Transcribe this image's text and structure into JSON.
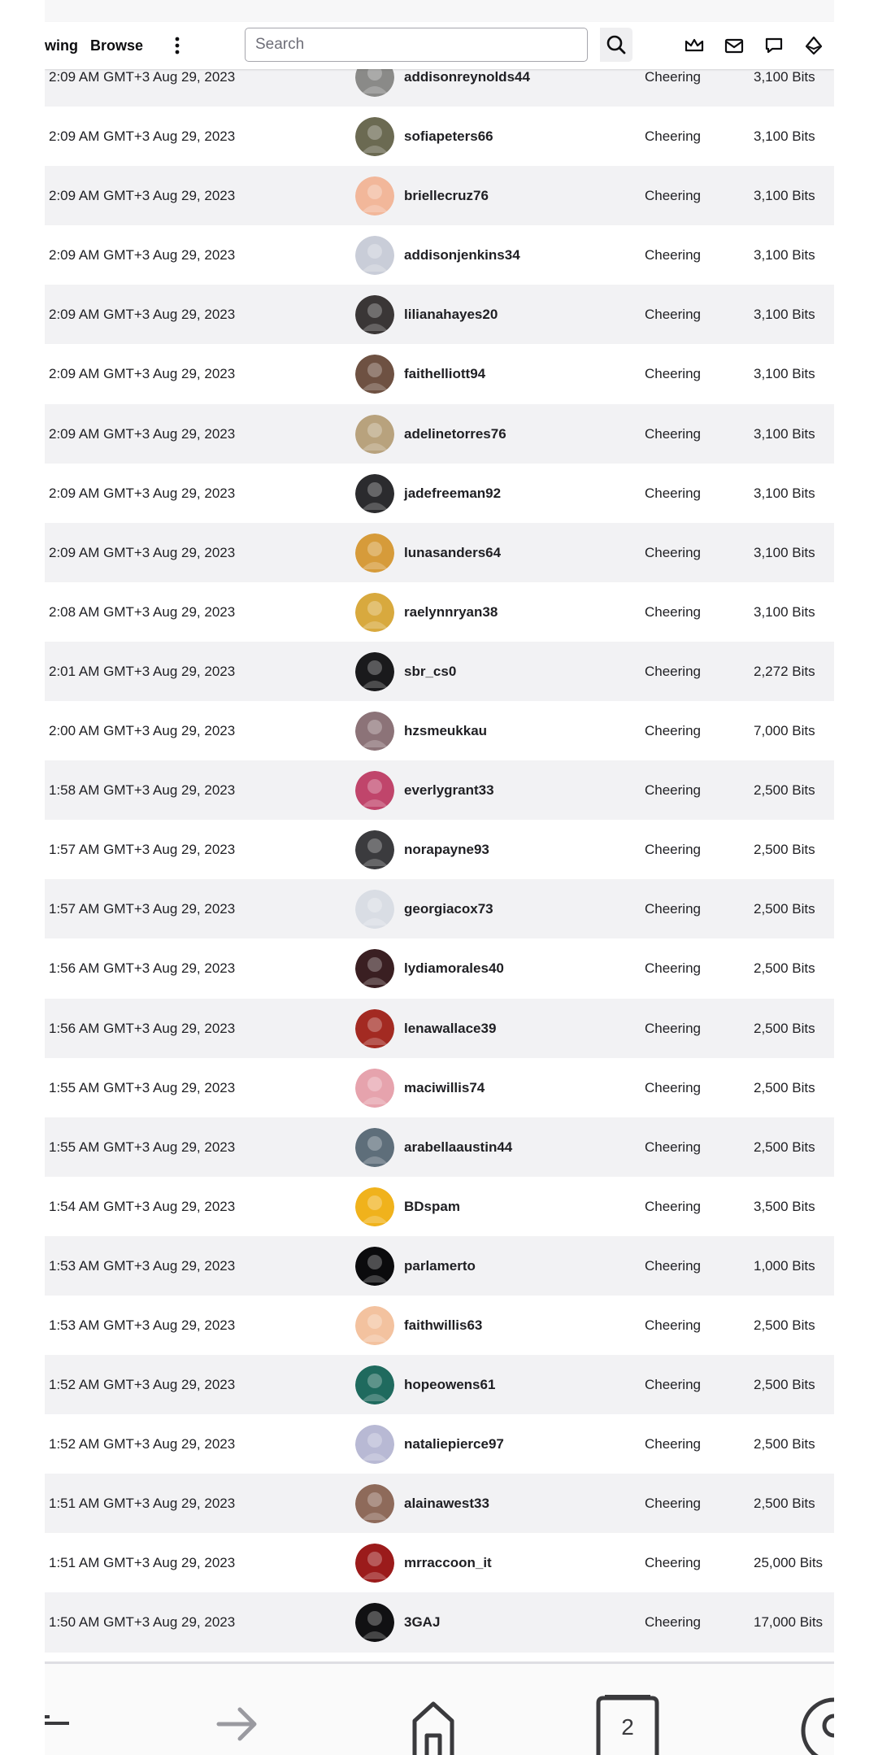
{
  "header": {
    "nav_following": "wing",
    "nav_browse": "Browse",
    "search_placeholder": "Search",
    "icons": [
      "more-vertical-icon",
      "search-icon",
      "crown-icon",
      "inbox-icon",
      "whispers-icon",
      "bits-icon"
    ]
  },
  "rows": [
    {
      "date": "2:09 AM GMT+3 Aug 29, 2023",
      "user": "addisonreynolds44",
      "type": "Cheering",
      "amount": "3,100 Bits",
      "avatar_color": "#8a8a88"
    },
    {
      "date": "2:09 AM GMT+3 Aug 29, 2023",
      "user": "sofiapeters66",
      "type": "Cheering",
      "amount": "3,100 Bits",
      "avatar_color": "#6b6a52"
    },
    {
      "date": "2:09 AM GMT+3 Aug 29, 2023",
      "user": "briellecruz76",
      "type": "Cheering",
      "amount": "3,100 Bits",
      "avatar_color": "#f2b79a"
    },
    {
      "date": "2:09 AM GMT+3 Aug 29, 2023",
      "user": "addisonjenkins34",
      "type": "Cheering",
      "amount": "3,100 Bits",
      "avatar_color": "#c9cdd8"
    },
    {
      "date": "2:09 AM GMT+3 Aug 29, 2023",
      "user": "lilianahayes20",
      "type": "Cheering",
      "amount": "3,100 Bits",
      "avatar_color": "#3a3636"
    },
    {
      "date": "2:09 AM GMT+3 Aug 29, 2023",
      "user": "faithelliott94",
      "type": "Cheering",
      "amount": "3,100 Bits",
      "avatar_color": "#6e5142"
    },
    {
      "date": "2:09 AM GMT+3 Aug 29, 2023",
      "user": "adelinetorres76",
      "type": "Cheering",
      "amount": "3,100 Bits",
      "avatar_color": "#b8a27d"
    },
    {
      "date": "2:09 AM GMT+3 Aug 29, 2023",
      "user": "jadefreeman92",
      "type": "Cheering",
      "amount": "3,100 Bits",
      "avatar_color": "#2b2b2e"
    },
    {
      "date": "2:09 AM GMT+3 Aug 29, 2023",
      "user": "lunasanders64",
      "type": "Cheering",
      "amount": "3,100 Bits",
      "avatar_color": "#d69b3a"
    },
    {
      "date": "2:08 AM GMT+3 Aug 29, 2023",
      "user": "raelynnryan38",
      "type": "Cheering",
      "amount": "3,100 Bits",
      "avatar_color": "#d8a93e"
    },
    {
      "date": "2:01 AM GMT+3 Aug 29, 2023",
      "user": "sbr_cs0",
      "type": "Cheering",
      "amount": "2,272 Bits",
      "avatar_color": "#1a1a1c"
    },
    {
      "date": "2:00 AM GMT+3 Aug 29, 2023",
      "user": "hzsmeukkau",
      "type": "Cheering",
      "amount": "7,000 Bits",
      "avatar_color": "#8c7378"
    },
    {
      "date": "1:58 AM GMT+3 Aug 29, 2023",
      "user": "everlygrant33",
      "type": "Cheering",
      "amount": "2,500 Bits",
      "avatar_color": "#c0456b"
    },
    {
      "date": "1:57 AM GMT+3 Aug 29, 2023",
      "user": "norapayne93",
      "type": "Cheering",
      "amount": "2,500 Bits",
      "avatar_color": "#3b3b3e"
    },
    {
      "date": "1:57 AM GMT+3 Aug 29, 2023",
      "user": "georgiacox73",
      "type": "Cheering",
      "amount": "2,500 Bits",
      "avatar_color": "#d9dde4"
    },
    {
      "date": "1:56 AM GMT+3 Aug 29, 2023",
      "user": "lydiamorales40",
      "type": "Cheering",
      "amount": "2,500 Bits",
      "avatar_color": "#3a1f22"
    },
    {
      "date": "1:56 AM GMT+3 Aug 29, 2023",
      "user": "lenawallace39",
      "type": "Cheering",
      "amount": "2,500 Bits",
      "avatar_color": "#a32a22"
    },
    {
      "date": "1:55 AM GMT+3 Aug 29, 2023",
      "user": "maciwillis74",
      "type": "Cheering",
      "amount": "2,500 Bits",
      "avatar_color": "#e6a3ad"
    },
    {
      "date": "1:55 AM GMT+3 Aug 29, 2023",
      "user": "arabellaaustin44",
      "type": "Cheering",
      "amount": "2,500 Bits",
      "avatar_color": "#5e6e7a"
    },
    {
      "date": "1:54 AM GMT+3 Aug 29, 2023",
      "user": "BDspam",
      "type": "Cheering",
      "amount": "3,500 Bits",
      "avatar_color": "#f0b21c"
    },
    {
      "date": "1:53 AM GMT+3 Aug 29, 2023",
      "user": "parlamerto",
      "type": "Cheering",
      "amount": "1,000 Bits",
      "avatar_color": "#0b0b0d"
    },
    {
      "date": "1:53 AM GMT+3 Aug 29, 2023",
      "user": "faithwillis63",
      "type": "Cheering",
      "amount": "2,500 Bits",
      "avatar_color": "#f3c29f"
    },
    {
      "date": "1:52 AM GMT+3 Aug 29, 2023",
      "user": "hopeowens61",
      "type": "Cheering",
      "amount": "2,500 Bits",
      "avatar_color": "#1f6a5e"
    },
    {
      "date": "1:52 AM GMT+3 Aug 29, 2023",
      "user": "nataliepierce97",
      "type": "Cheering",
      "amount": "2,500 Bits",
      "avatar_color": "#b8b9d4"
    },
    {
      "date": "1:51 AM GMT+3 Aug 29, 2023",
      "user": "alainawest33",
      "type": "Cheering",
      "amount": "2,500 Bits",
      "avatar_color": "#8e6a5a"
    },
    {
      "date": "1:51 AM GMT+3 Aug 29, 2023",
      "user": "mrraccoon_it",
      "type": "Cheering",
      "amount": "25,000 Bits",
      "avatar_color": "#9b1b1b"
    },
    {
      "date": "1:50 AM GMT+3 Aug 29, 2023",
      "user": "3GAJ",
      "type": "Cheering",
      "amount": "17,000 Bits",
      "avatar_color": "#111113"
    }
  ],
  "bottom_nav": {
    "tabs_count": "2",
    "icons": [
      "back-icon",
      "forward-icon",
      "home-icon",
      "tabs-icon",
      "profile-icon"
    ]
  }
}
